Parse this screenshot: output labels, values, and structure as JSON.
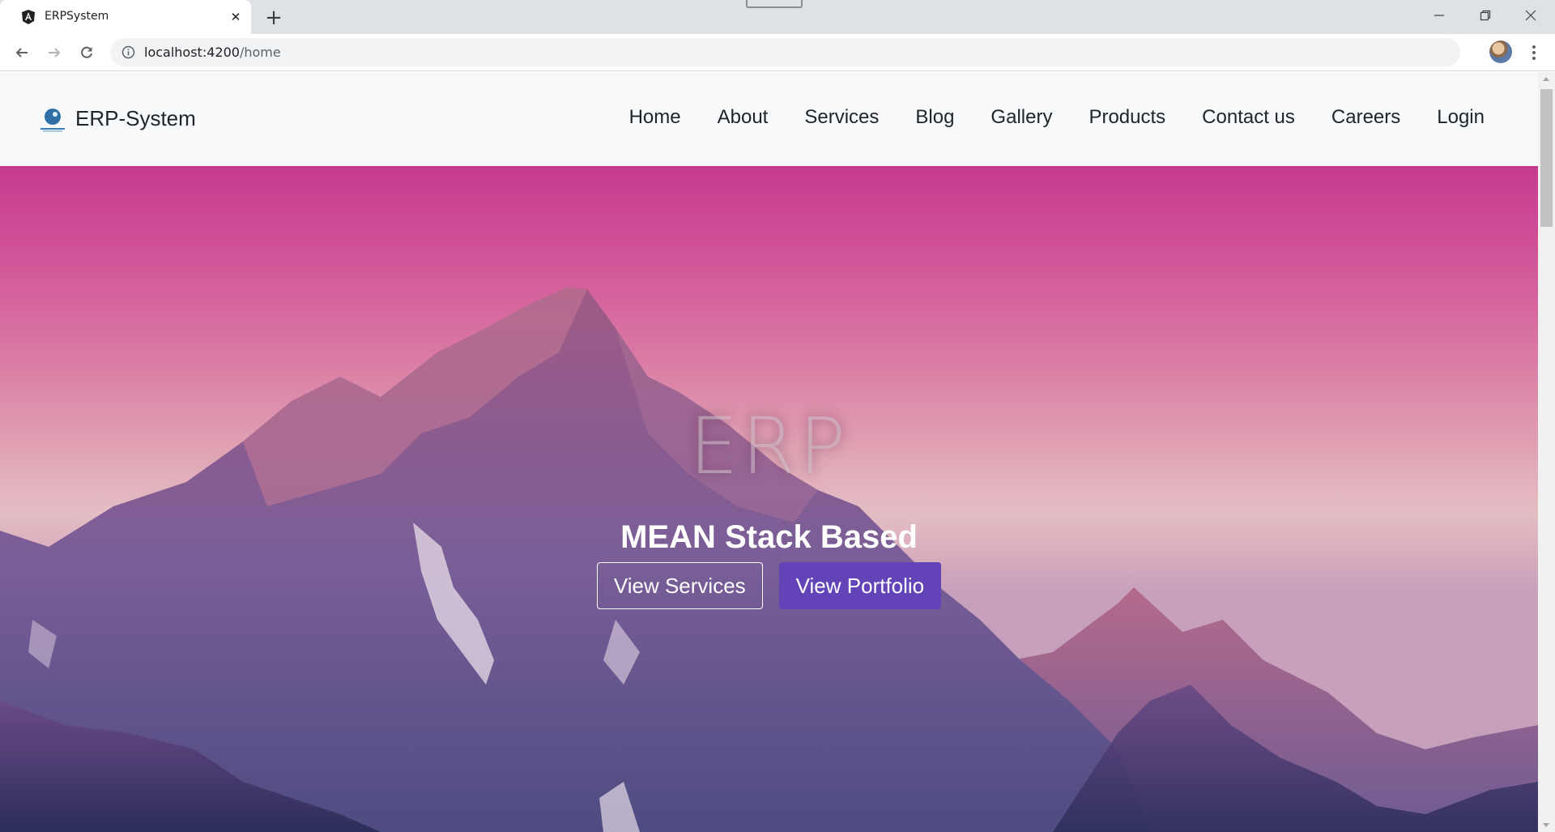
{
  "browser": {
    "tab_title": "ERPSystem",
    "tab_icon": "angular-icon",
    "url_host": "localhost:4200",
    "url_path": "/home",
    "colors": {
      "tabstrip": "#dee1e6",
      "omnibox": "#f1f3f4"
    }
  },
  "navbar": {
    "brand": "ERP-System",
    "links": [
      {
        "label": "Home"
      },
      {
        "label": "About"
      },
      {
        "label": "Services"
      },
      {
        "label": "Blog"
      },
      {
        "label": "Gallery"
      },
      {
        "label": "Products"
      },
      {
        "label": "Contact us"
      },
      {
        "label": "Careers"
      },
      {
        "label": "Login"
      }
    ]
  },
  "hero": {
    "title": "ERP",
    "subtitle": "MEAN Stack Based",
    "buttons": {
      "services": "View Services",
      "portfolio": "View Portfolio"
    },
    "colors": {
      "primary_button": "#6244b8",
      "sky_top": "#c63a8e"
    }
  }
}
